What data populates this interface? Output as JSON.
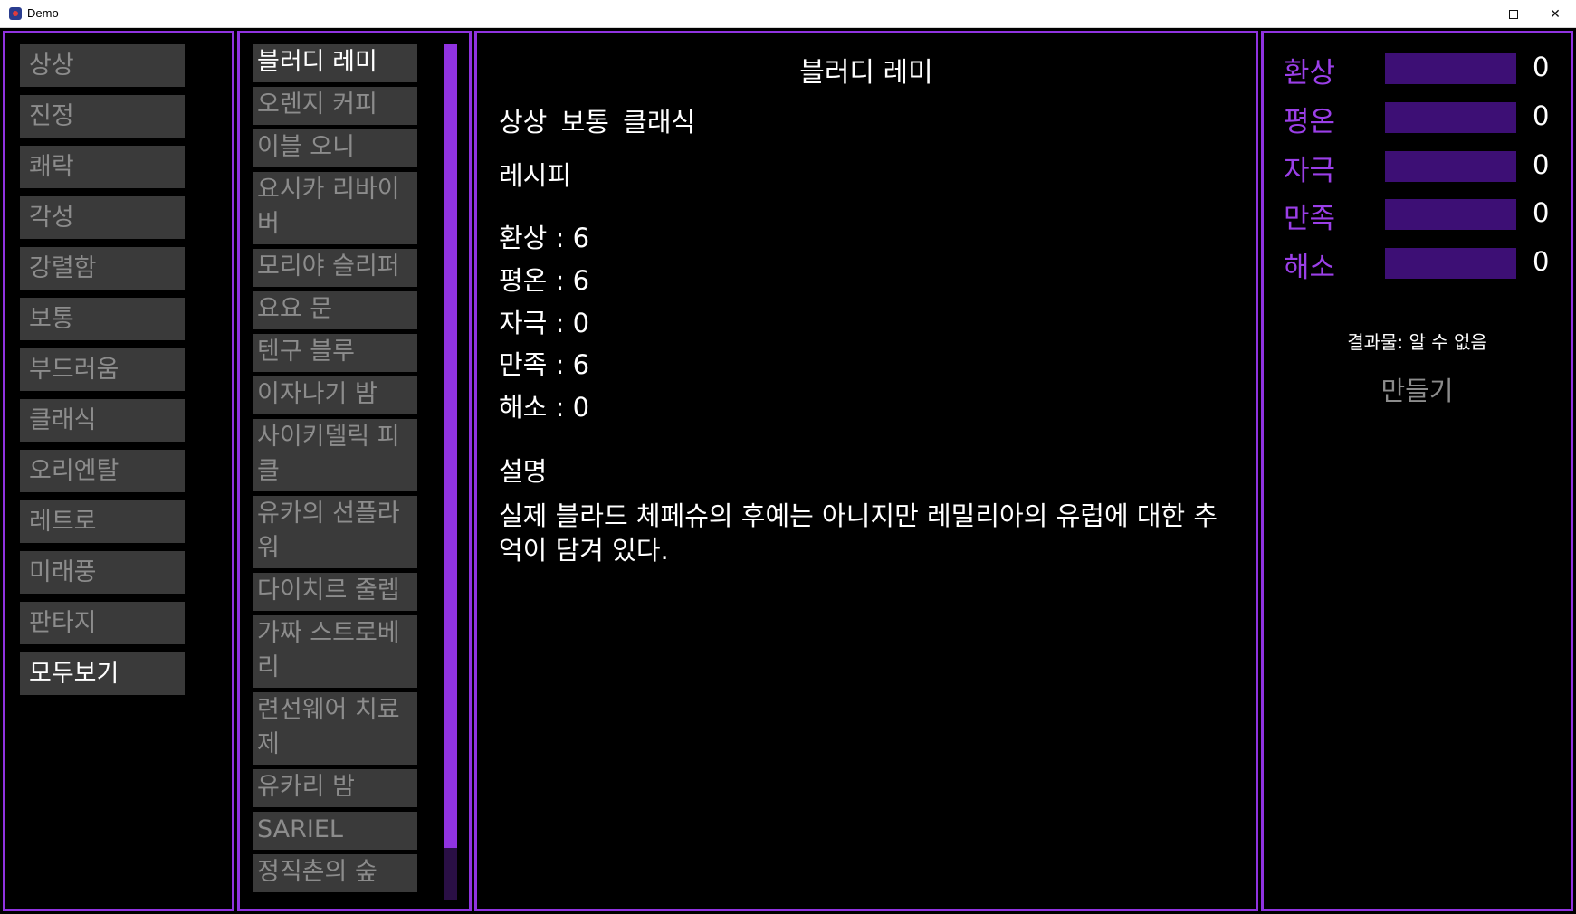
{
  "window": {
    "title": "Demo",
    "minimize_icon": "minimize-icon",
    "maximize_icon": "maximize-icon",
    "close_glyph": "✕"
  },
  "colors": {
    "accent": "#9033e0",
    "button_bg": "#3a3a3a",
    "button_text": "#8c8c8c",
    "meter_bg": "#3d0f75",
    "background": "#000000"
  },
  "categories": [
    {
      "label": "상상",
      "active": false
    },
    {
      "label": "진정",
      "active": false
    },
    {
      "label": "쾌락",
      "active": false
    },
    {
      "label": "각성",
      "active": false
    },
    {
      "label": "강렬함",
      "active": false
    },
    {
      "label": "보통",
      "active": false
    },
    {
      "label": "부드러움",
      "active": false
    },
    {
      "label": "클래식",
      "active": false
    },
    {
      "label": "오리엔탈",
      "active": false
    },
    {
      "label": "레트로",
      "active": false
    },
    {
      "label": "미래풍",
      "active": false
    },
    {
      "label": "판타지",
      "active": false
    },
    {
      "label": "모두보기",
      "active": true
    }
  ],
  "drinks": [
    {
      "label": "블러디 레미",
      "active": true
    },
    {
      "label": "오렌지 커피",
      "active": false
    },
    {
      "label": "이블 오니",
      "active": false
    },
    {
      "label": "요시카 리바이버",
      "active": false
    },
    {
      "label": "모리야 슬리퍼",
      "active": false
    },
    {
      "label": "요요 문",
      "active": false
    },
    {
      "label": "텐구 블루",
      "active": false
    },
    {
      "label": "이자나기 밤",
      "active": false
    },
    {
      "label": "사이키델릭 피클",
      "active": false
    },
    {
      "label": "유카의 선플라워",
      "active": false
    },
    {
      "label": "다이치르 줄렙",
      "active": false
    },
    {
      "label": "가짜 스트로베리",
      "active": false
    },
    {
      "label": "련선웨어 치료제",
      "active": false
    },
    {
      "label": "유카리 밤",
      "active": false
    },
    {
      "label": "SARIEL",
      "active": false
    },
    {
      "label": "정직촌의 숲",
      "active": false
    }
  ],
  "drink_scroll": {
    "position": 0.0,
    "visible_fraction": 0.94
  },
  "detail": {
    "title": "블러디 레미",
    "tags": "상상 보통 클래식",
    "recipe_heading": "레시피",
    "stats": [
      {
        "label": "환상",
        "value": "6"
      },
      {
        "label": "평온",
        "value": "6"
      },
      {
        "label": "자극",
        "value": "0"
      },
      {
        "label": "만족",
        "value": "6"
      },
      {
        "label": "해소",
        "value": "0"
      }
    ],
    "description_heading": "설명",
    "description": "실제 블라드 체페슈의 후예는 아니지만 레밀리아의 유럽에 대한 추억이 담겨 있다."
  },
  "meters": [
    {
      "label": "환상",
      "value": "0",
      "fill": 0
    },
    {
      "label": "평온",
      "value": "0",
      "fill": 0
    },
    {
      "label": "자극",
      "value": "0",
      "fill": 0
    },
    {
      "label": "만족",
      "value": "0",
      "fill": 0
    },
    {
      "label": "해소",
      "value": "0",
      "fill": 0
    }
  ],
  "result_text": "결과물: 알 수 없음",
  "make_label": "만들기"
}
